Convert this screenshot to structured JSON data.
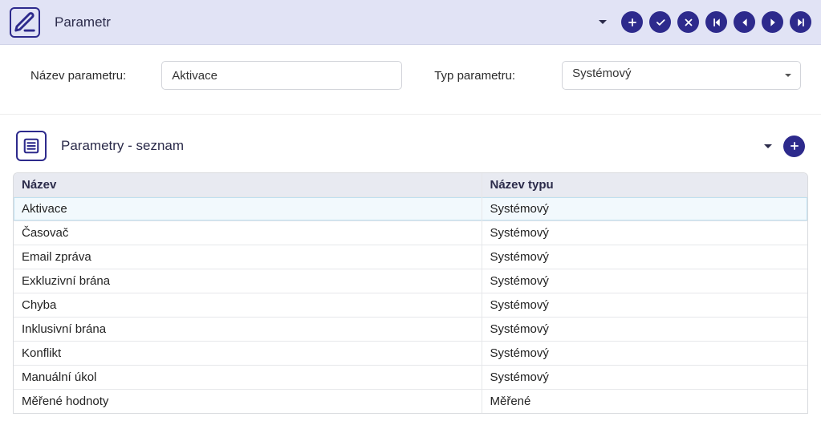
{
  "header": {
    "title": "Parametr"
  },
  "form": {
    "name_label": "Název parametru:",
    "name_value": "Aktivace",
    "type_label": "Typ parametru:",
    "type_value": "Systémový"
  },
  "list": {
    "title": "Parametry - seznam",
    "columns": {
      "name": "Název",
      "type": "Název typu"
    },
    "rows": [
      {
        "name": "Aktivace",
        "type": "Systémový",
        "selected": true
      },
      {
        "name": "Časovač",
        "type": "Systémový",
        "selected": false
      },
      {
        "name": "Email zpráva",
        "type": "Systémový",
        "selected": false
      },
      {
        "name": "Exkluzivní brána",
        "type": "Systémový",
        "selected": false
      },
      {
        "name": "Chyba",
        "type": "Systémový",
        "selected": false
      },
      {
        "name": "Inklusivní brána",
        "type": "Systémový",
        "selected": false
      },
      {
        "name": "Konflikt",
        "type": "Systémový",
        "selected": false
      },
      {
        "name": "Manuální úkol",
        "type": "Systémový",
        "selected": false
      },
      {
        "name": "Měřené hodnoty",
        "type": "Měřené",
        "selected": false
      }
    ]
  }
}
